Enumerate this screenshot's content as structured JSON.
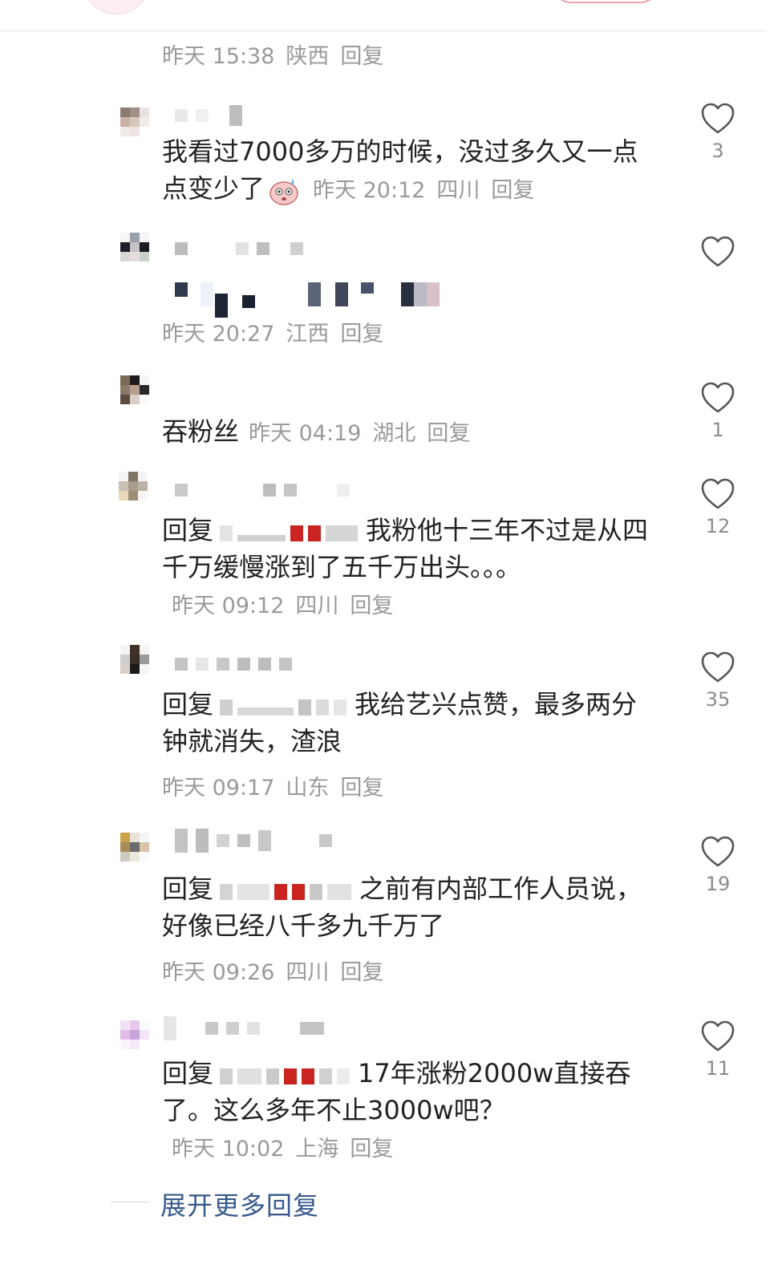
{
  "top_comment": {
    "time": "昨天 15:38",
    "location": "陕西",
    "reply_label": "回复"
  },
  "comments": [
    {
      "text": "我看过7000多万的时候，没过多久又一点点变少了",
      "emoji": "sweat-face",
      "time": "昨天 20:12",
      "location": "四川",
      "reply_label": "回复",
      "likes": "3"
    },
    {
      "text": "",
      "time": "昨天 20:27",
      "location": "江西",
      "reply_label": "回复",
      "likes": ""
    },
    {
      "text": "吞粉丝",
      "time": "昨天 04:19",
      "location": "湖北",
      "reply_label": "回复",
      "likes": "1"
    },
    {
      "reply_prefix": "回复",
      "text": "我粉他十三年不过是从四千万缓慢涨到了五千万出头。。。",
      "time": "昨天 09:12",
      "location": "四川",
      "reply_label": "回复",
      "likes": "12"
    },
    {
      "reply_prefix": "回复",
      "text": "我给艺兴点赞，最多两分钟就消失，渣浪",
      "time": "昨天 09:17",
      "location": "山东",
      "reply_label": "回复",
      "likes": "35"
    },
    {
      "reply_prefix": "回复",
      "text": "之前有内部工作人员说，好像已经八千多九千万了",
      "time": "昨天 09:26",
      "location": "四川",
      "reply_label": "回复",
      "likes": "19"
    },
    {
      "reply_prefix": "回复",
      "text": "17年涨粉2000w直接吞了。这么多年不止3000w吧？",
      "time": "昨天 10:02",
      "location": "上海",
      "reply_label": "回复",
      "likes": "11"
    }
  ],
  "expand_more": "展开更多回复",
  "colors": {
    "link": "#36598c",
    "meta": "#9a9a9a",
    "heart": "#555555"
  },
  "icons": {
    "like": "heart-outline-icon"
  }
}
